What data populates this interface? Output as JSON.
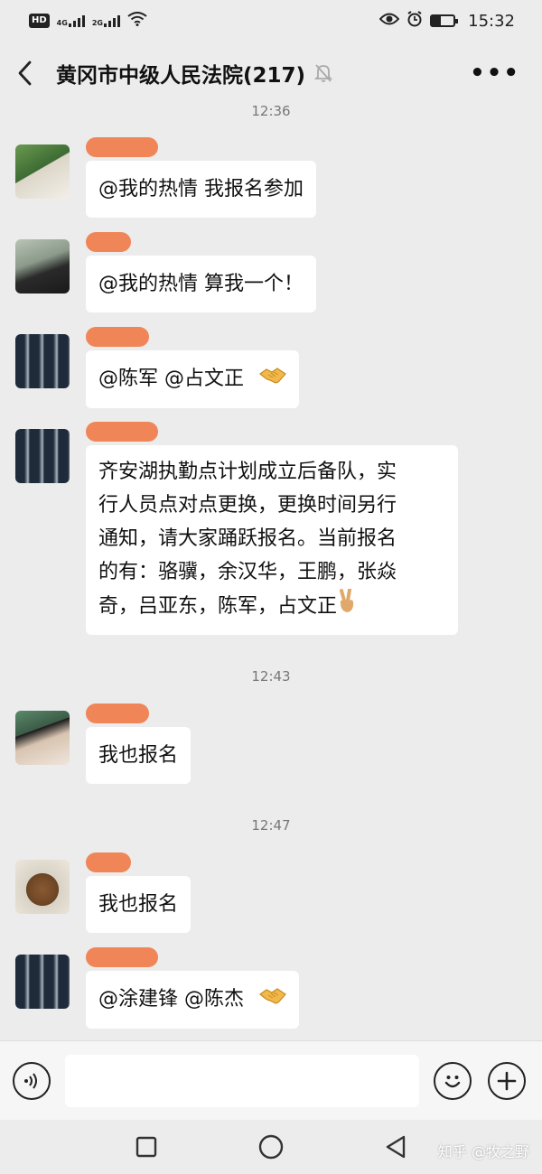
{
  "status_bar": {
    "hd": "HD",
    "net1": "4G",
    "net2": "2G",
    "time": "15:32"
  },
  "header": {
    "title": "黄冈市中级人民法院(217)"
  },
  "timestamps": [
    "12:36",
    "12:43",
    "12:47"
  ],
  "messages": [
    {
      "avatar": "avatar-girl",
      "text": "@我的热情  我报名参加"
    },
    {
      "avatar": "avatar-man",
      "text": "@我的热情  算我一个！"
    },
    {
      "avatar": "avatar-police",
      "text": "@陈军  @占文正",
      "emoji": "handshake-emoji"
    },
    {
      "avatar": "avatar-police",
      "lines": [
        "齐安湖执勤点计划成立后备队，实",
        "行人员点对点更换，更换时间另行",
        "通知，请大家踊跃报名。当前报名",
        "的有：骆骥，余汉华，王鹏，张焱",
        "奇，吕亚东，陈军，占文正"
      ],
      "emoji": "victory-hand-emoji"
    },
    {
      "avatar": "avatar-cap",
      "text": "我也报名"
    },
    {
      "avatar": "avatar-bear",
      "text": "我也报名"
    },
    {
      "avatar": "avatar-police",
      "text": "@涂建锋  @陈杰",
      "emoji": "handshake-emoji"
    }
  ],
  "input": {
    "placeholder": ""
  },
  "watermark": "知乎 @牧之野",
  "colors": {
    "background": "#ececec",
    "bubble": "#ffffff",
    "redaction": "#f08050"
  }
}
